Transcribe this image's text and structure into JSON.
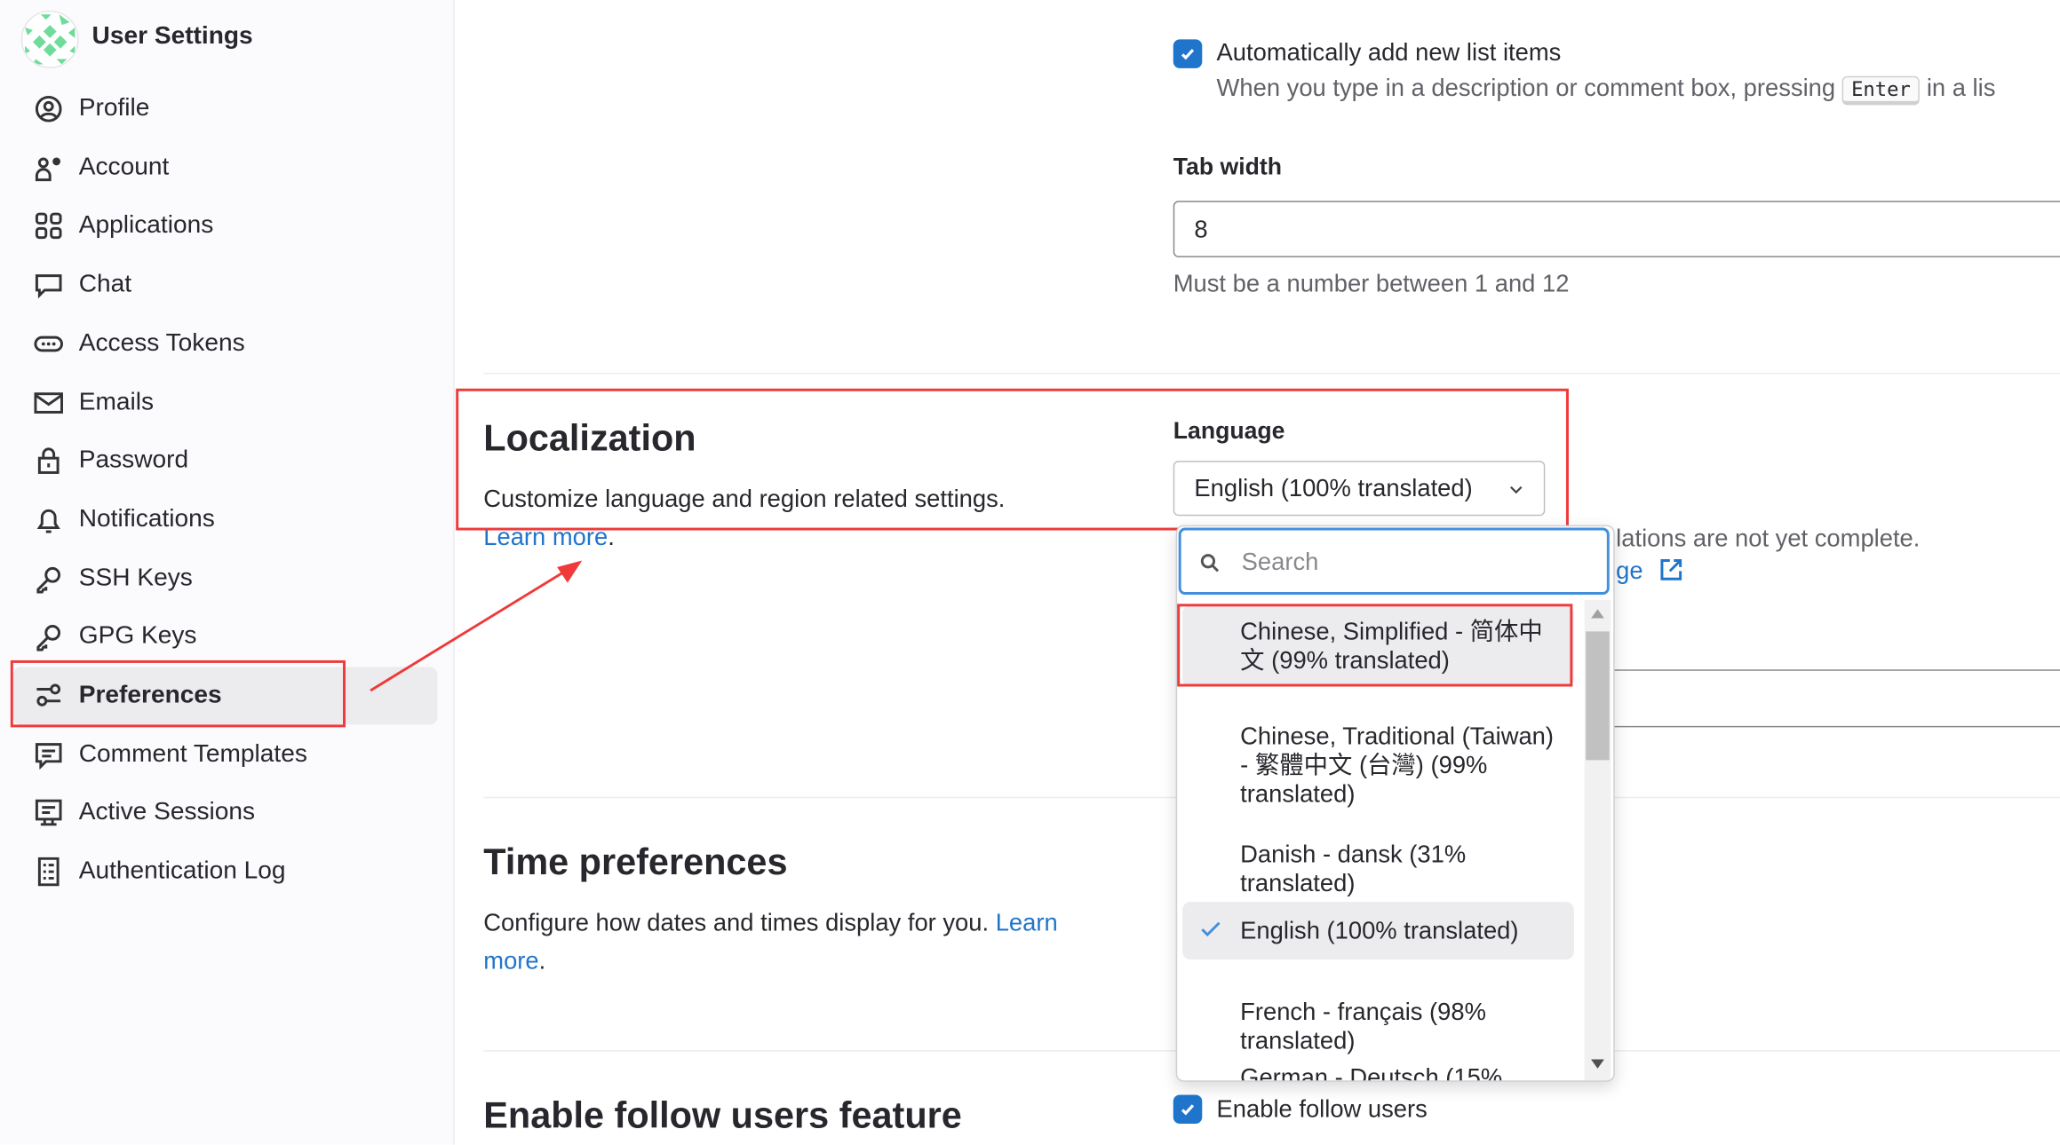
{
  "sidebar": {
    "title": "User Settings",
    "items": [
      {
        "label": "Profile",
        "icon": "profile-icon"
      },
      {
        "label": "Account",
        "icon": "account-icon"
      },
      {
        "label": "Applications",
        "icon": "applications-icon"
      },
      {
        "label": "Chat",
        "icon": "chat-icon"
      },
      {
        "label": "Access Tokens",
        "icon": "token-icon"
      },
      {
        "label": "Emails",
        "icon": "mail-icon"
      },
      {
        "label": "Password",
        "icon": "lock-icon"
      },
      {
        "label": "Notifications",
        "icon": "bell-icon"
      },
      {
        "label": "SSH Keys",
        "icon": "key-icon"
      },
      {
        "label": "GPG Keys",
        "icon": "key-icon"
      },
      {
        "label": "Preferences",
        "icon": "preferences-icon",
        "active": true
      },
      {
        "label": "Comment Templates",
        "icon": "comment-icon"
      },
      {
        "label": "Active Sessions",
        "icon": "monitor-icon"
      },
      {
        "label": "Authentication Log",
        "icon": "log-icon"
      }
    ]
  },
  "behavior": {
    "auto_list_label": "Automatically add new list items",
    "auto_list_checked": true,
    "auto_list_hint_pre": "When you type in a description or comment box, pressing",
    "auto_list_hint_kbd": "Enter",
    "auto_list_hint_post": "in a lis",
    "tab_width_label": "Tab width",
    "tab_width_value": "8",
    "tab_width_help": "Must be a number between 1 and 12"
  },
  "localization": {
    "title": "Localization",
    "description": "Customize language and region related settings.",
    "learn_more": "Learn more",
    "language_label": "Language",
    "language_selected": "English (100% translated)",
    "help_partial": "lations are not yet complete.",
    "help_link_partial": "ge",
    "dropdown": {
      "search_placeholder": "Search",
      "options": [
        {
          "label": "Chinese, Simplified - 简体中文 (99% translated)",
          "highlighted": true
        },
        {
          "label": "Chinese, Traditional (Taiwan) - 繁體中文 (台灣) (99% translated)"
        },
        {
          "label": "Danish - dansk (31% translated)"
        },
        {
          "label": "English (100% translated)",
          "selected": true
        },
        {
          "label": "French - français (98% translated)"
        },
        {
          "label": "German - Deutsch (15%"
        }
      ]
    }
  },
  "time": {
    "title": "Time preferences",
    "description": "Configure how dates and times display for you.",
    "learn": "Learn",
    "more": "more"
  },
  "follow": {
    "title": "Enable follow users feature",
    "checkbox_label": "Enable follow users",
    "checked": true
  },
  "colors": {
    "accent": "#1f75cb",
    "annotation": "#f03a3a",
    "logo": "#6fdc9b"
  }
}
